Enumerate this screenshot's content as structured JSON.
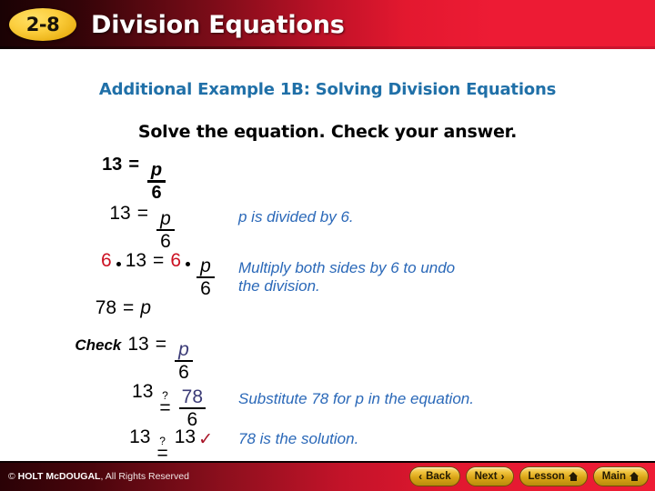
{
  "header": {
    "badge": "2-8",
    "title": "Division Equations",
    "accent_red": "#ED1B34",
    "badge_gold": "#F0C33C"
  },
  "subtitle": "Additional Example 1B: Solving Division Equations",
  "prompt": "Solve the equation. Check your answer.",
  "colors": {
    "subtitle_blue": "#2070A8",
    "note_blue": "#2A68B8",
    "multiplier_red": "#CC1122",
    "check_navy": "#3B3B77",
    "tick_red": "#A81427"
  },
  "steps": [
    {
      "id": "problem",
      "left": "13",
      "equals": "=",
      "numerator": "p",
      "denominator": "6",
      "note": ""
    },
    {
      "id": "restate",
      "left": "13",
      "equals": "=",
      "numerator": "p",
      "denominator": "6",
      "note": "p is divided by 6."
    },
    {
      "id": "multiply-both-sides",
      "multiplier": "6",
      "left": "13",
      "equals": "=",
      "right_multiplier": "6",
      "numerator": "p",
      "denominator": "6",
      "note": "Multiply both sides by 6 to undo\nthe division."
    },
    {
      "id": "solution",
      "left": "78",
      "equals": "=",
      "right": "p",
      "note": ""
    }
  ],
  "check": {
    "label": "Check",
    "rows": [
      {
        "id": "check-original",
        "left": "13",
        "equals": "=",
        "numerator": "p",
        "denominator": "6",
        "note": ""
      },
      {
        "id": "check-substitute",
        "left": "13",
        "question": "?",
        "equals": "=",
        "numerator": "78",
        "denominator": "6",
        "note": "Substitute 78 for p in the equation."
      },
      {
        "id": "check-result",
        "left": "13",
        "question": "?",
        "equals": "=",
        "right": "13",
        "tick": "✓",
        "note": "78 is the solution."
      }
    ]
  },
  "footer": {
    "copyright_symbol": "©",
    "copyright_brand": "HOLT McDOUGAL",
    "copyright_rest": ", All Rights Reserved",
    "buttons": [
      {
        "id": "back",
        "label": "Back",
        "icon": "chevron-left-icon",
        "glyph": "‹"
      },
      {
        "id": "next",
        "label": "Next",
        "icon": "chevron-right-icon",
        "glyph": "›"
      },
      {
        "id": "lesson",
        "label": "Lesson",
        "icon": "home-icon",
        "glyph": ""
      },
      {
        "id": "main",
        "label": "Main",
        "icon": "home-icon",
        "glyph": ""
      }
    ]
  }
}
